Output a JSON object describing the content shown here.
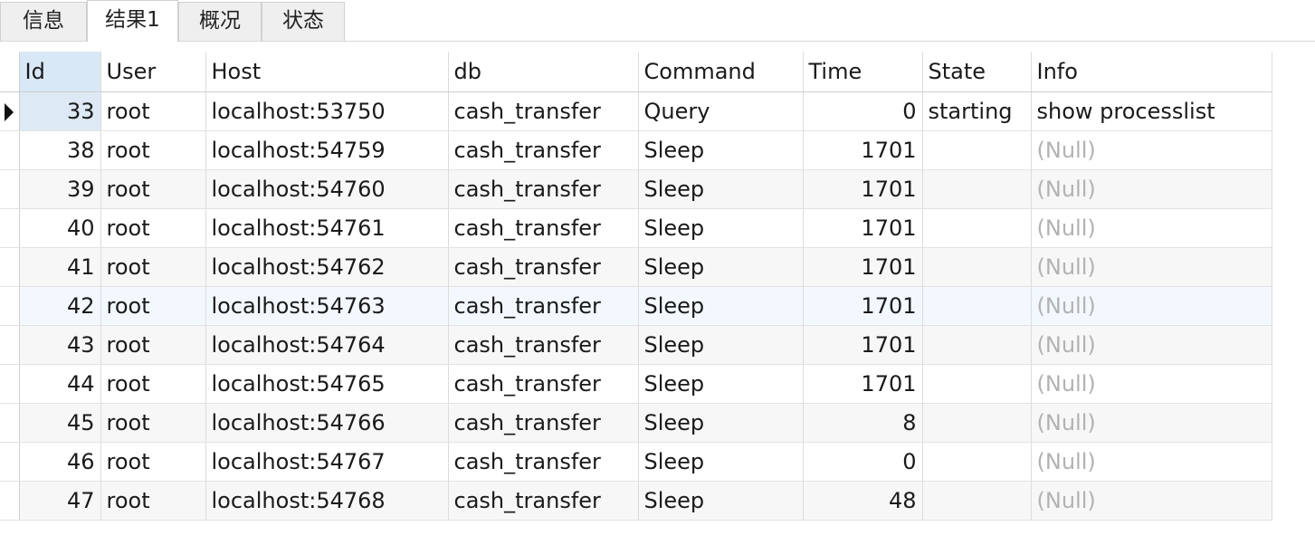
{
  "tabs": [
    {
      "label": "信息",
      "active": false
    },
    {
      "label": "结果1",
      "active": true
    },
    {
      "label": "概况",
      "active": false
    },
    {
      "label": "状态",
      "active": false
    }
  ],
  "grid": {
    "columns": [
      "Id",
      "User",
      "Host",
      "db",
      "Command",
      "Time",
      "State",
      "Info"
    ],
    "rows": [
      [
        "33",
        "root",
        "localhost:53750",
        "cash_transfer",
        "Query",
        "0",
        "starting",
        "show processlist"
      ],
      [
        "38",
        "root",
        "localhost:54759",
        "cash_transfer",
        "Sleep",
        "1701",
        "",
        "(Null)"
      ],
      [
        "39",
        "root",
        "localhost:54760",
        "cash_transfer",
        "Sleep",
        "1701",
        "",
        "(Null)"
      ],
      [
        "40",
        "root",
        "localhost:54761",
        "cash_transfer",
        "Sleep",
        "1701",
        "",
        "(Null)"
      ],
      [
        "41",
        "root",
        "localhost:54762",
        "cash_transfer",
        "Sleep",
        "1701",
        "",
        "(Null)"
      ],
      [
        "42",
        "root",
        "localhost:54763",
        "cash_transfer",
        "Sleep",
        "1701",
        "",
        "(Null)"
      ],
      [
        "43",
        "root",
        "localhost:54764",
        "cash_transfer",
        "Sleep",
        "1701",
        "",
        "(Null)"
      ],
      [
        "44",
        "root",
        "localhost:54765",
        "cash_transfer",
        "Sleep",
        "1701",
        "",
        "(Null)"
      ],
      [
        "45",
        "root",
        "localhost:54766",
        "cash_transfer",
        "Sleep",
        "8",
        "",
        "(Null)"
      ],
      [
        "46",
        "root",
        "localhost:54767",
        "cash_transfer",
        "Sleep",
        "0",
        "",
        "(Null)"
      ],
      [
        "47",
        "root",
        "localhost:54768",
        "cash_transfer",
        "Sleep",
        "48",
        "",
        "(Null)"
      ]
    ],
    "current_row_icon": "row-pointer-icon",
    "colors": {
      "header_selected_bg": "#d9e8f6",
      "null_text": "#b2b2b2",
      "alt_row_bg": "#f7f7f7",
      "hover_row_bg": "#f2f8fd"
    }
  }
}
